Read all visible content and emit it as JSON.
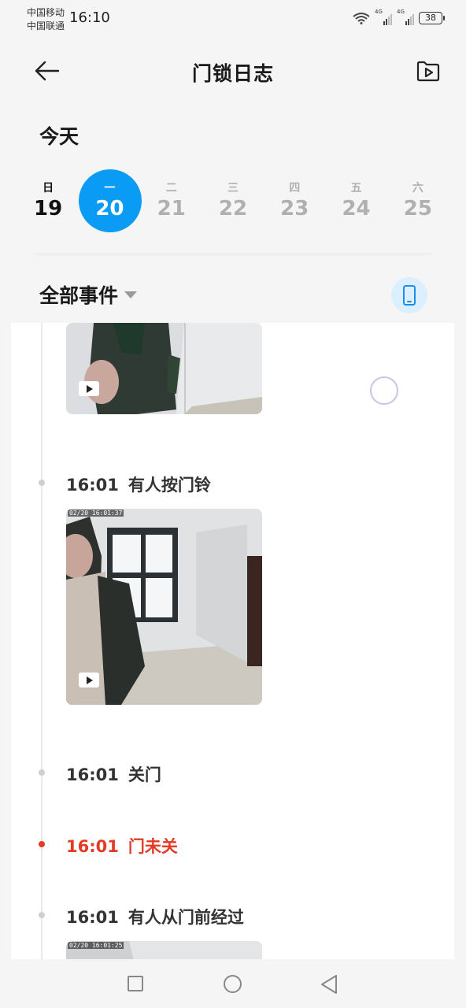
{
  "status_bar": {
    "carrier_1": "中国移动",
    "carrier_2": "中国联通",
    "time": "16:10",
    "signal_1_label": "4G",
    "signal_2_label": "4G",
    "battery": "38"
  },
  "header": {
    "title": "门锁日志",
    "back_icon": "arrow-left-icon",
    "video_icon": "video-folder-icon"
  },
  "date_section": {
    "today_label": "今天",
    "days": [
      {
        "weekday": "日",
        "date": "19",
        "state": "past"
      },
      {
        "weekday": "一",
        "date": "20",
        "state": "selected"
      },
      {
        "weekday": "二",
        "date": "21",
        "state": "future"
      },
      {
        "weekday": "三",
        "date": "22",
        "state": "future"
      },
      {
        "weekday": "四",
        "date": "23",
        "state": "future"
      },
      {
        "weekday": "五",
        "date": "24",
        "state": "future"
      },
      {
        "weekday": "六",
        "date": "25",
        "state": "future"
      }
    ],
    "accent_color": "#0a9cf5"
  },
  "filter": {
    "label": "全部事件",
    "phone_icon": "phone-icon"
  },
  "events": [
    {
      "time": "16:01",
      "text": "有人按门铃",
      "has_video": true,
      "video_timestamp": "02/20 16:01:37",
      "alert": false
    },
    {
      "time": "16:01",
      "text": "关门",
      "has_video": false,
      "alert": false
    },
    {
      "time": "16:01",
      "text": "门未关",
      "has_video": false,
      "alert": true,
      "color": "#e33b25"
    },
    {
      "time": "16:01",
      "text": "有人从门前经过",
      "has_video": true,
      "video_timestamp": "02/20 16:01:25",
      "alert": false
    }
  ],
  "nav_bar": {
    "recent_icon": "square-icon",
    "home_icon": "circle-icon",
    "back_icon": "triangle-back-icon"
  }
}
